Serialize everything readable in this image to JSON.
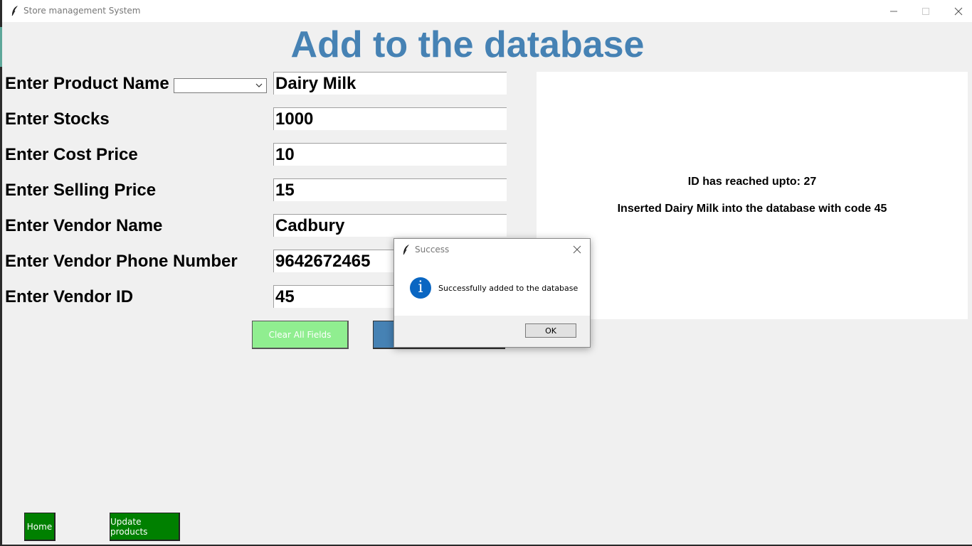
{
  "window": {
    "title": "Store management System",
    "feather_icon": "feather-icon",
    "controls": [
      "minimize-icon",
      "maximize-icon",
      "close-icon"
    ]
  },
  "heading": "Add to the database",
  "form": {
    "product_name": {
      "label": "Enter Product Name",
      "dropdown_value": "",
      "value": "Dairy Milk"
    },
    "stocks": {
      "label": "Enter Stocks",
      "value": "1000"
    },
    "cost_price": {
      "label": "Enter Cost Price",
      "value": "10"
    },
    "selling_price": {
      "label": "Enter Selling Price",
      "value": "15"
    },
    "vendor_name": {
      "label": "Enter Vendor Name",
      "value": "Cadbury"
    },
    "vendor_phone": {
      "label": "Enter Vendor Phone Number",
      "value": "9642672465"
    },
    "vendor_id": {
      "label": "Enter Vendor ID",
      "value": "45"
    }
  },
  "buttons": {
    "clear": "Clear All Fields",
    "home": "Home",
    "update": "Update products"
  },
  "status_panel": {
    "id_line": "ID has reached upto: 27",
    "insert_line": "Inserted Dairy Milk into the database with code 45"
  },
  "dialog": {
    "title": "Success",
    "message": "Successfully added to the database",
    "ok": "OK",
    "icon": "info-icon"
  },
  "colors": {
    "heading": "#4682b4",
    "clear_button": "#90ee90",
    "add_button": "#4682b4",
    "nav_button": "#008000"
  }
}
